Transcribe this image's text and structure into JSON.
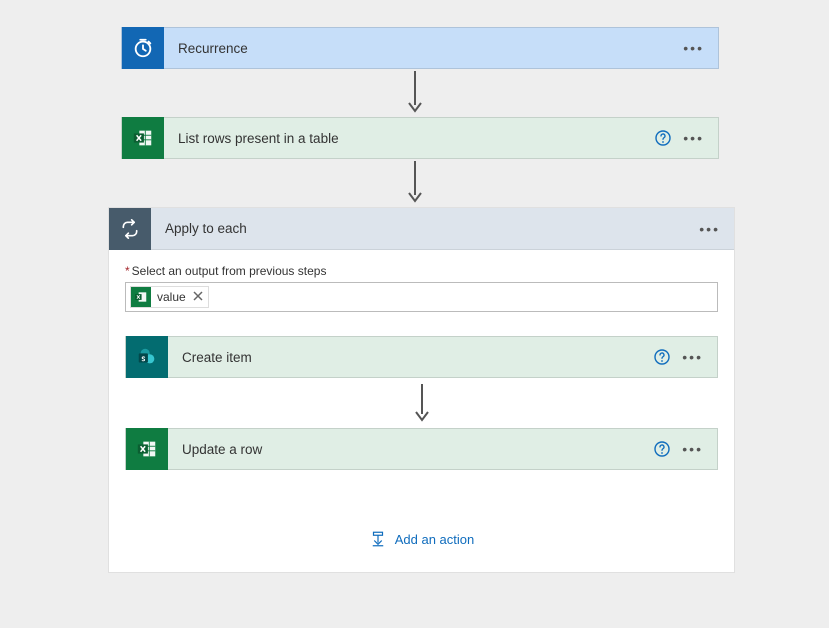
{
  "recurrence": {
    "label": "Recurrence"
  },
  "listRows": {
    "label": "List rows present in a table"
  },
  "applyEach": {
    "label": "Apply to each",
    "fieldLabel": "Select an output from previous steps",
    "token": "value"
  },
  "createItem": {
    "label": "Create item"
  },
  "updateRow": {
    "label": "Update a row"
  },
  "addAction": {
    "label": "Add an action"
  }
}
